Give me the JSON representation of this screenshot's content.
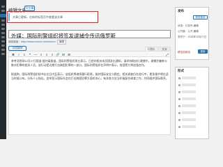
{
  "header": {
    "title": "编辑文章",
    "add_new_label": "写文章"
  },
  "notice": {
    "text": "文章已更新。在新的标签页中查看该文章"
  },
  "post": {
    "title": "外媒：国际刑警组织将签发逮捕令传讯俄罗斯",
    "permalink_label": "固定链接：",
    "permalink_url": "https://www.xxxxxx.com/xxxxxx",
    "permalink_edit_label": "编辑"
  },
  "editor": {
    "add_media_label": "添加媒体",
    "tab_visual": "可视化",
    "tab_text": "文本",
    "toolbar": [
      "B",
      "I",
      "≡",
      "❝",
      "—",
      "≡",
      "≡",
      "≡",
      "🔗",
      "⊟",
      "⊞"
    ],
    "paragraphs": [
      "参考消息网12月27日报道 据外媒报道，国际刑警组织周五表示，已经向相关成员国发出通知，请求协助执行逮捕令，逮捕涉嫌参与欺诈犯罪的相关人员，该行动是近期打击跨国犯罪的一部分。国际刑警组织在声明中表示，各国警方将加强合作。",
      "报道称，国际刑警组织秘书长在日内瓦表示，该组织将继续履行职责，维护国际安全与稳定。相关调查仍在进行中，更多细节将在适当时候公布。分析人士指出，此举显示国际社会在打击跨国犯罪方面的决心，有关各方应当积极配合调查工作，共同维护国际秩序。"
    ]
  },
  "sidebar": {
    "publish_title": "发布",
    "preview_label": "预览更改",
    "status_line": "状态：已发布 编辑",
    "visibility_line": "公开度：公开 编辑",
    "date_line": "发布于：2018年12月27日",
    "trash_label": "移至回收站",
    "update_label": "更新",
    "format_title": "形式",
    "format_count": 8
  },
  "colors": {
    "accent": "#2271b1",
    "highlight_border": "#e0232b",
    "admin_bar": "#23282d"
  }
}
